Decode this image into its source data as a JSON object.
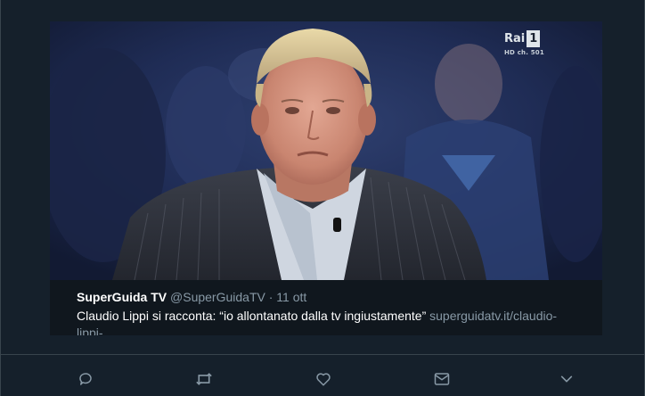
{
  "media": {
    "channel_logo_word": "Rai",
    "channel_logo_number": "1",
    "channel_logo_sub": "HD ch. 501"
  },
  "tweet": {
    "author": "SuperGuida TV",
    "handle": "@SuperGuidaTV",
    "separator": "·",
    "time": "11 ott",
    "text": "Claudio Lippi si racconta: “io allontanato dalla tv ingiustamente” ",
    "link": "superguidatv.it/claudio-lippi-…"
  },
  "actions": [
    {
      "icon": "reply-icon"
    },
    {
      "icon": "retweet-icon"
    },
    {
      "icon": "like-icon"
    },
    {
      "icon": "message-icon"
    },
    {
      "icon": "chevron-down-icon"
    }
  ],
  "colors": {
    "background": "#15202b",
    "secondary_text": "#8899a6",
    "primary_text": "#ffffff",
    "divider": "#38444d"
  }
}
